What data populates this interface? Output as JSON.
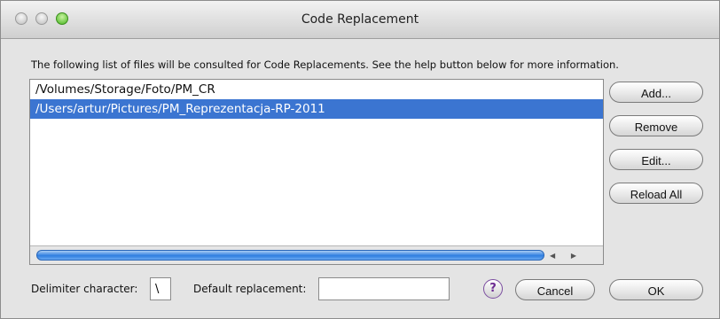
{
  "window": {
    "title": "Code Replacement"
  },
  "description": "The following list of files will be consulted for Code Replacements.  See the help button below for more information.",
  "files": [
    "/Volumes/Storage/Foto/PM_CR",
    "/Users/artur/Pictures/PM_Reprezentacja-RP-2011"
  ],
  "selected_index": 1,
  "buttons": {
    "add": "Add...",
    "remove": "Remove",
    "edit": "Edit...",
    "reload_all": "Reload All",
    "help": "?",
    "cancel": "Cancel",
    "ok": "OK"
  },
  "footer": {
    "delimiter_label": "Delimiter character:",
    "delimiter_value": "\\",
    "default_label": "Default replacement:",
    "default_value": ""
  },
  "colors": {
    "selection": "#3b75d1"
  }
}
